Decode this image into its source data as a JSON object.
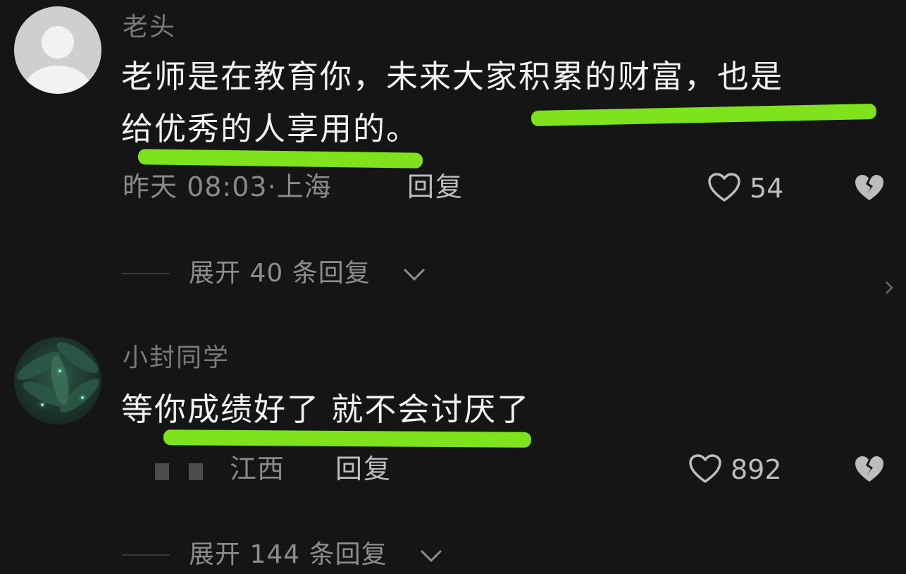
{
  "comments": [
    {
      "username": "老头",
      "text_line1": "老师是在教育你，未来大家积累的财富，也是",
      "text_line2": "给优秀的人享用的。",
      "time": "昨天 08:03·上海",
      "reply_label": "回复",
      "likes": "54",
      "expand_label": "展开 40 条回复"
    },
    {
      "username": "小封同学",
      "text": "等你成绩好了 就不会讨厌了",
      "location": "江西",
      "reply_label": "回复",
      "likes": "892",
      "expand_label": "展开 144 条回复"
    }
  ],
  "icons": {
    "like": "heart-outline-icon",
    "dislike": "broken-heart-icon",
    "expand": "chevron-down-icon",
    "side": "chevron-right-icon"
  },
  "colors": {
    "highlight": "#7ee21c",
    "background": "#151515"
  }
}
